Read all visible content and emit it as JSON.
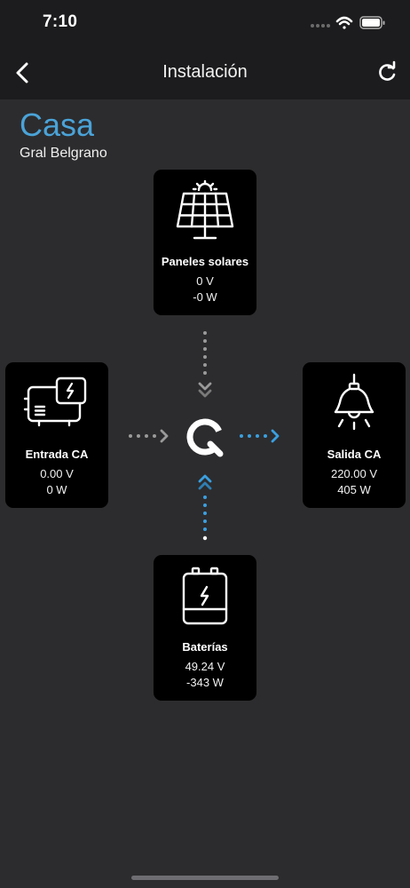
{
  "status_bar": {
    "time": "7:10",
    "icons": [
      "signal-icon",
      "wifi-icon",
      "battery-icon"
    ]
  },
  "nav": {
    "title": "Instalación",
    "back_icon": "chevron-left-icon",
    "refresh_icon": "refresh-icon"
  },
  "site": {
    "name": "Casa",
    "location": "Gral Belgrano"
  },
  "colors": {
    "accent": "#4aa3d8",
    "background": "#2c2c2e",
    "bar": "#1c1c1e",
    "card": "#000000",
    "flow_inactive": "#9a9a9a",
    "flow_active": "#3aa0e0"
  },
  "cards": {
    "solar": {
      "label": "Paneles solares",
      "voltage": "0 V",
      "power": "-0 W",
      "icon": "solar-panel-icon"
    },
    "input": {
      "label": "Entrada CA",
      "voltage": "0.00 V",
      "power": "0 W",
      "icon": "generator-icon"
    },
    "output": {
      "label": "Salida CA",
      "voltage": "220.00 V",
      "power": "405 W",
      "icon": "lamp-icon"
    },
    "battery": {
      "label": "Baterías",
      "voltage": "49.24 V",
      "power": "-343 W",
      "icon": "battery-charge-icon"
    }
  },
  "hub": {
    "icon": "inverter-logo-icon"
  }
}
